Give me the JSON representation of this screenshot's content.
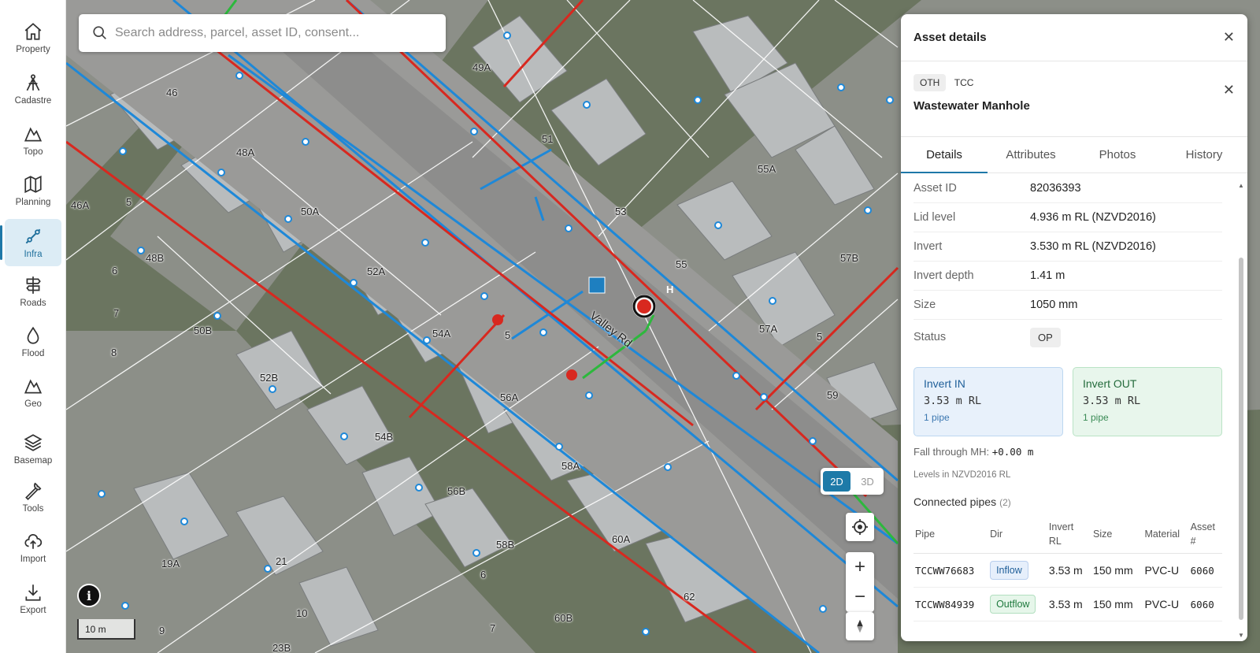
{
  "sidebar": {
    "items": [
      {
        "label": "Property",
        "icon": "home-icon"
      },
      {
        "label": "Cadastre",
        "icon": "survey-tripod-icon"
      },
      {
        "label": "Topo",
        "icon": "mountain-icon"
      },
      {
        "label": "Planning",
        "icon": "map-icon"
      },
      {
        "label": "Infra",
        "icon": "pipe-network-icon",
        "active": true
      },
      {
        "label": "Roads",
        "icon": "signpost-icon"
      },
      {
        "label": "Flood",
        "icon": "water-drop-icon"
      },
      {
        "label": "Geo",
        "icon": "mountain-icon"
      },
      {
        "label": "Basemap",
        "icon": "layers-icon"
      },
      {
        "label": "Tools",
        "icon": "wrench-icon"
      },
      {
        "label": "Import",
        "icon": "cloud-upload-icon"
      },
      {
        "label": "Export",
        "icon": "download-icon"
      }
    ]
  },
  "search": {
    "placeholder": "Search address, parcel, asset ID, consent..."
  },
  "map": {
    "lots": [
      "49A",
      "46",
      "48A",
      "51",
      "46A",
      "5",
      "50A",
      "53",
      "55A",
      "6",
      "48B",
      "52A",
      "55",
      "57B",
      "7",
      "50B",
      "54A",
      "8",
      "52B",
      "56A",
      "57A",
      "54B",
      "58A",
      "59",
      "56B",
      "58B",
      "60A",
      "19A",
      "21",
      "6",
      "62",
      "10",
      "60B",
      "7",
      "9",
      "5",
      "5",
      "23B"
    ],
    "road_name": "Valley Rd",
    "road_name_partial": "Va Rd",
    "hydrant_label": "H",
    "scale_label": "10 m",
    "info_label": "i",
    "toggle": {
      "d2": "2D",
      "d3": "3D",
      "active": "2D"
    },
    "zoom_in": "+",
    "zoom_out": "−"
  },
  "panel": {
    "title": "Asset details",
    "asset": {
      "class_code": "OTH",
      "owner": "TCC",
      "name": "Wastewater Manhole"
    },
    "tabs": [
      "Details",
      "Attributes",
      "Photos",
      "History"
    ],
    "active_tab": "Details",
    "details": [
      {
        "key": "Asset ID",
        "value": "82036393"
      },
      {
        "key": "Lid level",
        "value": "4.936 m RL (NZVD2016)"
      },
      {
        "key": "Invert",
        "value": "3.530 m RL (NZVD2016)"
      },
      {
        "key": "Invert depth",
        "value": "1.41 m"
      },
      {
        "key": "Size",
        "value": "1050 mm"
      }
    ],
    "status": {
      "key": "Status",
      "value": "OP"
    },
    "invert_in": {
      "title": "Invert IN",
      "value": "3.53 m RL",
      "sub": "1 pipe"
    },
    "invert_out": {
      "title": "Invert OUT",
      "value": "3.53 m RL",
      "sub": "1 pipe"
    },
    "fall": {
      "label": "Fall through MH:",
      "value": "+0.00 m"
    },
    "levels_note": "Levels in NZVD2016 RL",
    "connected": {
      "title": "Connected pipes",
      "count": "(2)",
      "headers": {
        "pipe": "Pipe",
        "dir": "Dir",
        "invert_a": "Invert",
        "invert_b": "RL",
        "size": "Size",
        "material": "Material",
        "asset_a": "Asset",
        "asset_b": "#"
      },
      "rows": [
        {
          "pipe": "TCCWW76683",
          "dir": "Inflow",
          "invert": "3.53 m",
          "size": "150 mm",
          "material": "PVC-U",
          "asset": "6060"
        },
        {
          "pipe": "TCCWW84939",
          "dir": "Outflow",
          "invert": "3.53 m",
          "size": "150 mm",
          "material": "PVC-U",
          "asset": "6060"
        }
      ]
    }
  },
  "colors": {
    "accent": "#1e78a8",
    "water": "#1e88d8",
    "wastewater": "#d8281f",
    "stormwater": "#2db83d"
  }
}
